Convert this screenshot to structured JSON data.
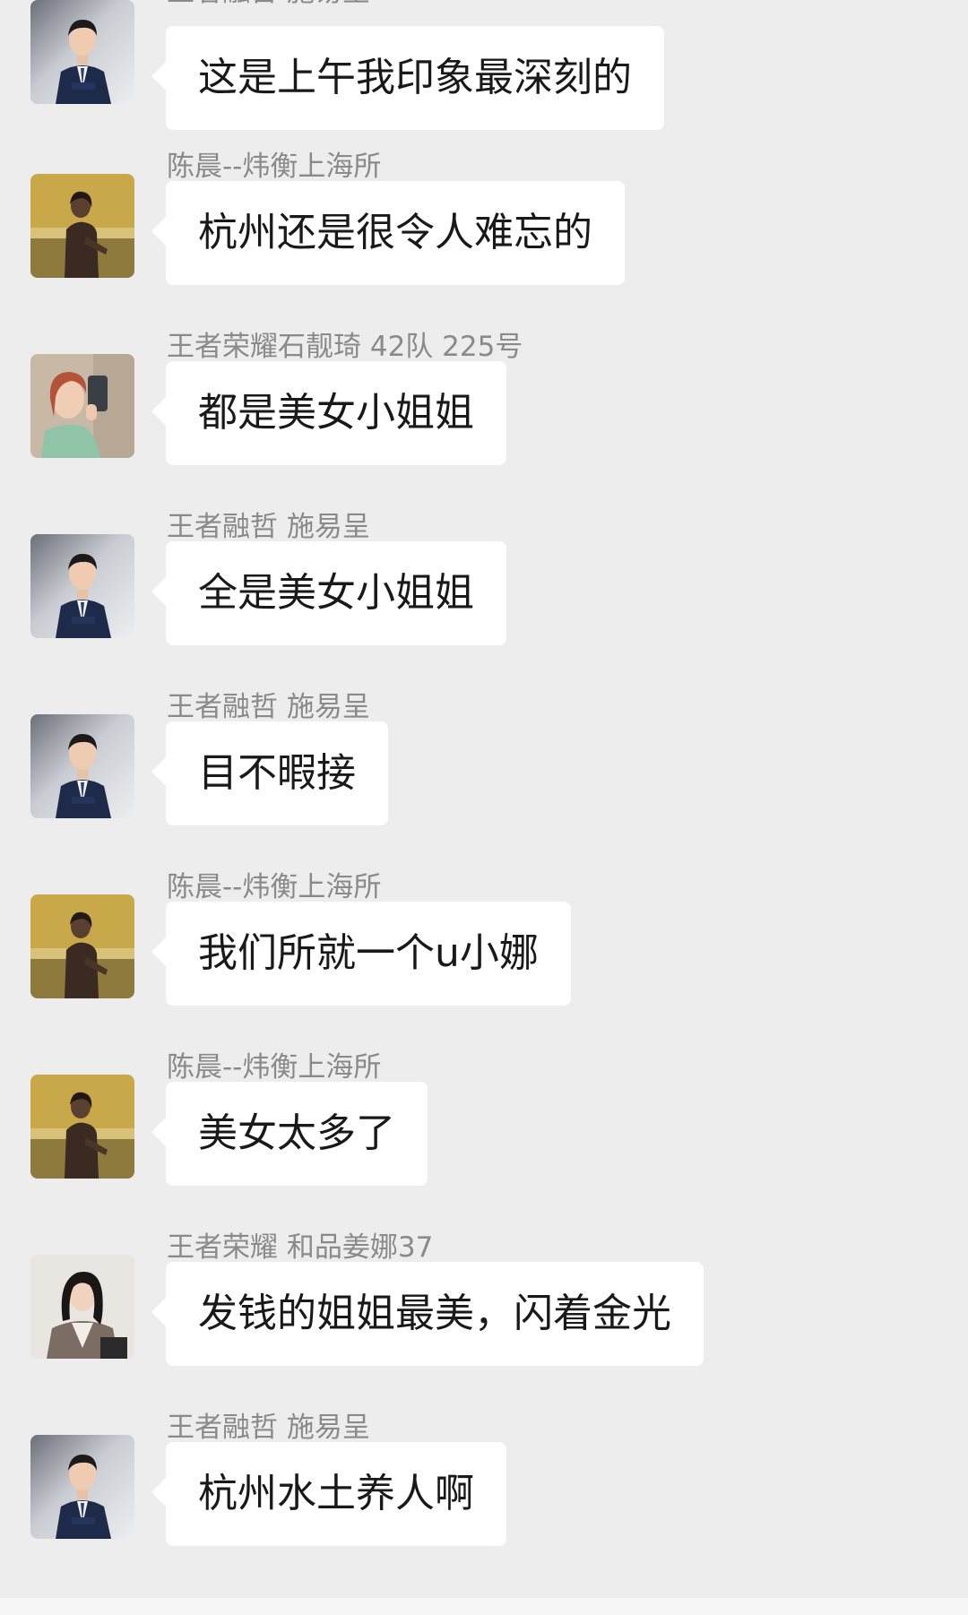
{
  "messages": [
    {
      "sender": "王者融哲 施易呈",
      "text": "这是上午我印象最深刻的",
      "avatar": "avatar-man-suit"
    },
    {
      "sender": "陈晨--炜衡上海所",
      "text": "杭州还是很令人难忘的",
      "avatar": "avatar-person-yellow-bg"
    },
    {
      "sender": "王者荣耀石靓琦 42队 225号",
      "text": "都是美女小姐姐",
      "avatar": "avatar-woman-selfie"
    },
    {
      "sender": "王者融哲 施易呈",
      "text": "全是美女小姐姐",
      "avatar": "avatar-man-suit"
    },
    {
      "sender": "王者融哲 施易呈",
      "text": "目不暇接",
      "avatar": "avatar-man-suit"
    },
    {
      "sender": "陈晨--炜衡上海所",
      "text": "我们所就一个u小娜",
      "avatar": "avatar-person-yellow-bg"
    },
    {
      "sender": "陈晨--炜衡上海所",
      "text": "美女太多了",
      "avatar": "avatar-person-yellow-bg"
    },
    {
      "sender": "王者荣耀 和品姜娜37",
      "text": "发钱的姐姐最美，闪着金光",
      "avatar": "avatar-woman-portrait"
    },
    {
      "sender": "王者融哲 施易呈",
      "text": "杭州水土养人啊",
      "avatar": "avatar-man-suit"
    }
  ],
  "colors": {
    "background": "#ededed",
    "bubble": "#ffffff",
    "sender_text": "#8a8a8a",
    "message_text": "#191919"
  }
}
